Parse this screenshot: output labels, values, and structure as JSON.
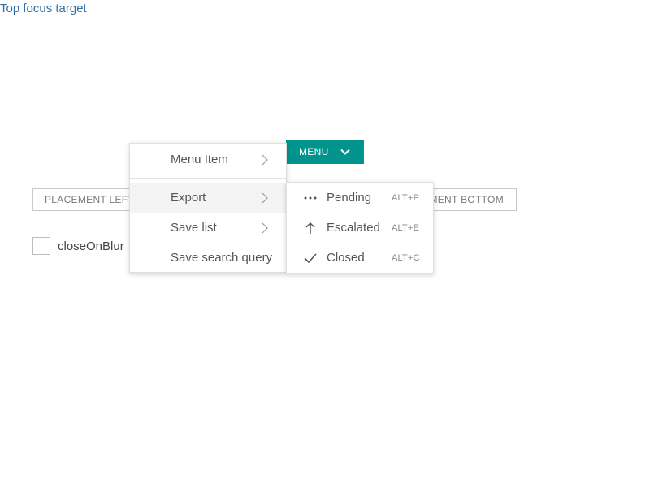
{
  "top_link": "Top focus target",
  "placement_left_button": "PLACEMENT LEFT",
  "placement_bottom_button": "PLACEMENT BOTTOM",
  "checkbox": {
    "label": "closeOnBlur",
    "checked": false
  },
  "menu_button": {
    "label": "MENU",
    "icon": "chevron-down-icon",
    "color": "#00948c"
  },
  "menu": {
    "items": [
      {
        "label": "Menu Item",
        "has_submenu": true
      },
      {
        "label": "Export",
        "has_submenu": true,
        "active": true
      },
      {
        "label": "Save list",
        "has_submenu": true
      },
      {
        "label": "Save search query",
        "has_submenu": false
      }
    ]
  },
  "submenu": {
    "items": [
      {
        "label": "Pending",
        "shortcut": "ALT+P",
        "icon": "more-dots-icon"
      },
      {
        "label": "Escalated",
        "shortcut": "ALT+E",
        "icon": "arrow-up-icon"
      },
      {
        "label": "Closed",
        "shortcut": "ALT+C",
        "icon": "checkmark-icon"
      }
    ]
  }
}
